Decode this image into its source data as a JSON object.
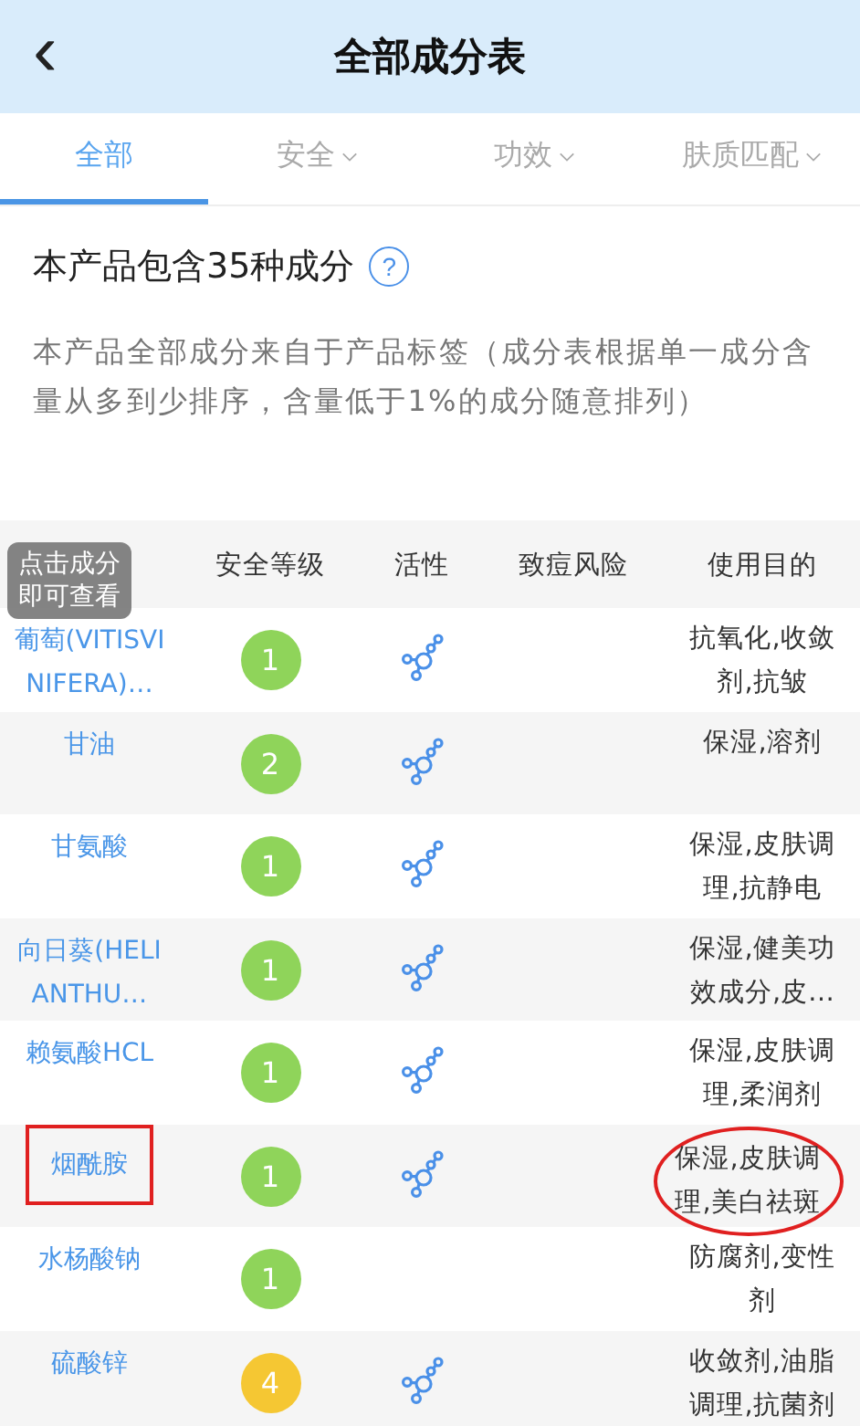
{
  "header": {
    "back_icon": "‹",
    "title": "全部成分表"
  },
  "tabs": [
    {
      "label": "全部",
      "selected": true,
      "dropdown": false
    },
    {
      "label": "安全",
      "selected": false,
      "dropdown": true
    },
    {
      "label": "功效",
      "selected": false,
      "dropdown": true
    },
    {
      "label": "肤质匹配",
      "selected": false,
      "dropdown": true
    }
  ],
  "summary": {
    "title": "本产品包含35种成分",
    "help_icon": "?",
    "note": "本产品全部成分来自于产品标签（成分表根据单一成分含量从多到少排序，含量低于1%的成分随意排列）"
  },
  "table": {
    "columns": [
      "安全等级",
      "活性",
      "致痘风险",
      "使用目的"
    ],
    "tooltip": "点击成分即可查看",
    "rows": [
      {
        "name": "葡萄(VITISVINIFERA)…",
        "safety": "1",
        "color": "#8fd45a",
        "active": true,
        "purpose": "抗氧化,收敛剂,抗皱",
        "marked": false
      },
      {
        "name": "甘油",
        "safety": "2",
        "color": "#8fd45a",
        "active": true,
        "purpose": "保湿,溶剂",
        "marked": false
      },
      {
        "name": "甘氨酸",
        "safety": "1",
        "color": "#8fd45a",
        "active": true,
        "purpose": "保湿,皮肤调理,抗静电",
        "marked": false
      },
      {
        "name": "向日葵(HELIANTHU…",
        "safety": "1",
        "color": "#8fd45a",
        "active": true,
        "purpose": "保湿,健美功效成分,皮…",
        "marked": false
      },
      {
        "name": "赖氨酸HCL",
        "safety": "1",
        "color": "#8fd45a",
        "active": true,
        "purpose": "保湿,皮肤调理,柔润剂",
        "marked": false
      },
      {
        "name": "烟酰胺",
        "safety": "1",
        "color": "#8fd45a",
        "active": true,
        "purpose": "保湿,皮肤调理,美白祛斑",
        "marked": true
      },
      {
        "name": "水杨酸钠",
        "safety": "1",
        "color": "#8fd45a",
        "active": false,
        "purpose": "防腐剂,变性剂",
        "marked": false
      },
      {
        "name": "硫酸锌",
        "safety": "4",
        "color": "#f5c733",
        "active": true,
        "purpose": "收敛剂,油脂调理,抗菌剂",
        "marked": false
      }
    ]
  }
}
